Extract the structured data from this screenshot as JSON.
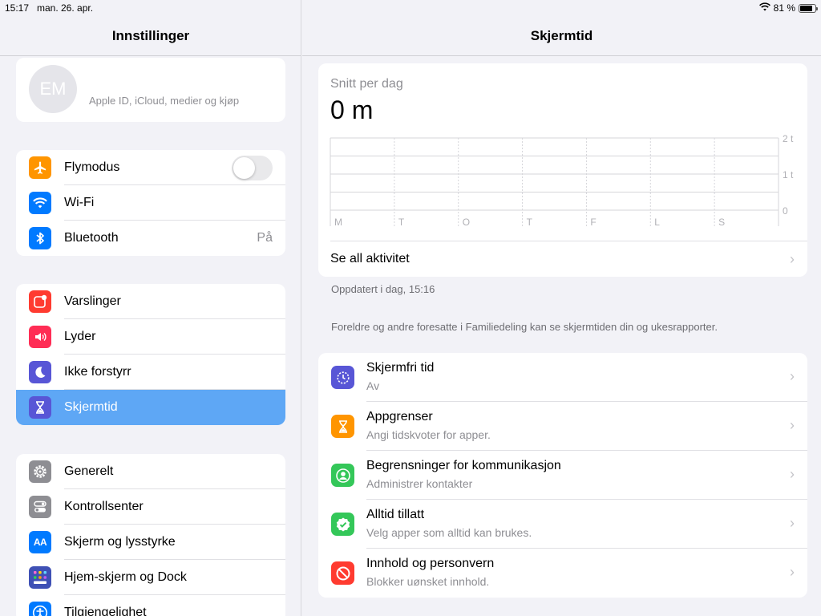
{
  "status": {
    "time": "15:17",
    "date": "man. 26. apr.",
    "battery": "81 %",
    "battery_level": 0.81
  },
  "sidebar": {
    "title": "Innstillinger",
    "profile": {
      "initials": "EM",
      "subtitle": "Apple ID, iCloud, medier og kjøp"
    },
    "group1": [
      {
        "label": "Flymodus",
        "icon": "airplane-icon",
        "color": "#ff9500"
      },
      {
        "label": "Wi-Fi",
        "icon": "wifi-icon",
        "color": "#007aff"
      },
      {
        "label": "Bluetooth",
        "icon": "bluetooth-icon",
        "color": "#007aff",
        "value": "På"
      }
    ],
    "group2": [
      {
        "label": "Varslinger",
        "icon": "notifications-icon",
        "color": "#ff3b30"
      },
      {
        "label": "Lyder",
        "icon": "speaker-icon",
        "color": "#ff2d55"
      },
      {
        "label": "Ikke forstyrr",
        "icon": "moon-icon",
        "color": "#5856d6"
      },
      {
        "label": "Skjermtid",
        "icon": "hourglass-icon",
        "color": "#5856d6",
        "selected": true
      }
    ],
    "group3": [
      {
        "label": "Generelt",
        "icon": "gear-icon",
        "color": "#8e8e93"
      },
      {
        "label": "Kontrollsenter",
        "icon": "toggles-icon",
        "color": "#8e8e93"
      },
      {
        "label": "Skjerm og lysstyrke",
        "icon": "text-size-icon",
        "color": "#007aff"
      },
      {
        "label": "Hjem-skjerm og Dock",
        "icon": "grid-icon",
        "color": "#3f51b5"
      },
      {
        "label": "Tilgjengelighet",
        "icon": "accessibility-icon",
        "color": "#007aff"
      }
    ]
  },
  "detail": {
    "title": "Skjermtid",
    "avg_label": "Snitt per dag",
    "avg_value": "0 m",
    "see_all": "Se all aktivitet",
    "updated": "Oppdatert i dag, 15:16",
    "family_note": "Foreldre og andre foresatte i Familiedeling kan se skjermtiden din og ukesrapporter.",
    "options": [
      {
        "title": "Skjermfri tid",
        "subtitle": "Av",
        "icon": "downtime-icon",
        "color": "#5856d6"
      },
      {
        "title": "Appgrenser",
        "subtitle": "Angi tidskvoter for apper.",
        "icon": "hourglass-icon",
        "color": "#ff9500"
      },
      {
        "title": "Begrensninger for kommunikasjon",
        "subtitle": "Administrer kontakter",
        "icon": "contact-icon",
        "color": "#34c759"
      },
      {
        "title": "Alltid tillatt",
        "subtitle": "Velg apper som alltid kan brukes.",
        "icon": "checkmark-seal-icon",
        "color": "#34c759"
      },
      {
        "title": "Innhold og personvern",
        "subtitle": "Blokker uønsket innhold.",
        "icon": "restriction-icon",
        "color": "#ff3b30"
      }
    ]
  },
  "chart_data": {
    "type": "bar",
    "categories": [
      "M",
      "T",
      "O",
      "T",
      "F",
      "L",
      "S"
    ],
    "values": [
      0,
      0,
      0,
      0,
      0,
      0,
      0
    ],
    "y_ticks": [
      "2 t",
      "1 t",
      "0"
    ],
    "ylim": [
      0,
      2
    ]
  }
}
